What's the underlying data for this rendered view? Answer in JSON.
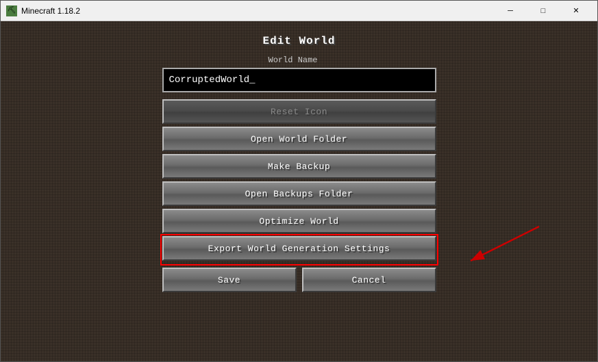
{
  "window": {
    "title": "Minecraft 1.18.2",
    "icon": "🟩"
  },
  "titlebar": {
    "minimize_label": "─",
    "maximize_label": "□",
    "close_label": "✕"
  },
  "dialog": {
    "title": "Edit World",
    "world_name_label": "World Name",
    "world_name_value": "CorruptedWorld_",
    "world_name_placeholder": "World Name"
  },
  "buttons": {
    "reset_icon": "Reset Icon",
    "open_world_folder": "Open World Folder",
    "make_backup": "Make Backup",
    "open_backups_folder": "Open Backups Folder",
    "optimize_world": "Optimize World",
    "export_world_generation": "Export World Generation Settings",
    "save": "Save",
    "cancel": "Cancel"
  }
}
